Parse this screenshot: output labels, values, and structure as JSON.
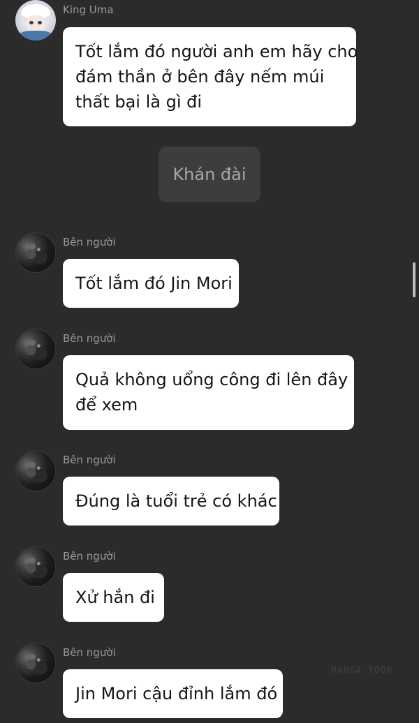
{
  "messages": [
    {
      "sender": "King Uma",
      "avatar": "king-uma-avatar",
      "lines": [
        "Tốt lắm đó người anh em hãy cho",
        "đám thần ở bên đây nếm múi",
        "thất bại là gì đi"
      ]
    },
    {
      "sender": "Bên người",
      "avatar": "dark-hooded-avatar",
      "lines": [
        "Tốt lắm đó Jin Mori"
      ]
    },
    {
      "sender": "Bên người",
      "avatar": "dark-hooded-avatar",
      "lines": [
        "Quả không uổng công đi lên đây",
        "để xem"
      ]
    },
    {
      "sender": "Bên người",
      "avatar": "dark-hooded-avatar",
      "lines": [
        "Đúng là tuổi trẻ có khác"
      ]
    },
    {
      "sender": "Bên người",
      "avatar": "dark-hooded-avatar",
      "lines": [
        "Xử hắn đi"
      ]
    },
    {
      "sender": "Bên người",
      "avatar": "dark-hooded-avatar",
      "lines": [
        "Jin Mori cậu đỉnh lắm đó"
      ]
    }
  ],
  "system_notice": "Khán đài",
  "watermark": "MANGA TOON",
  "colors": {
    "background": "#2b2b2b",
    "bubble": "#ffffff",
    "system_bubble": "#3d3d3d",
    "sender_name": "#9a9a9a"
  }
}
